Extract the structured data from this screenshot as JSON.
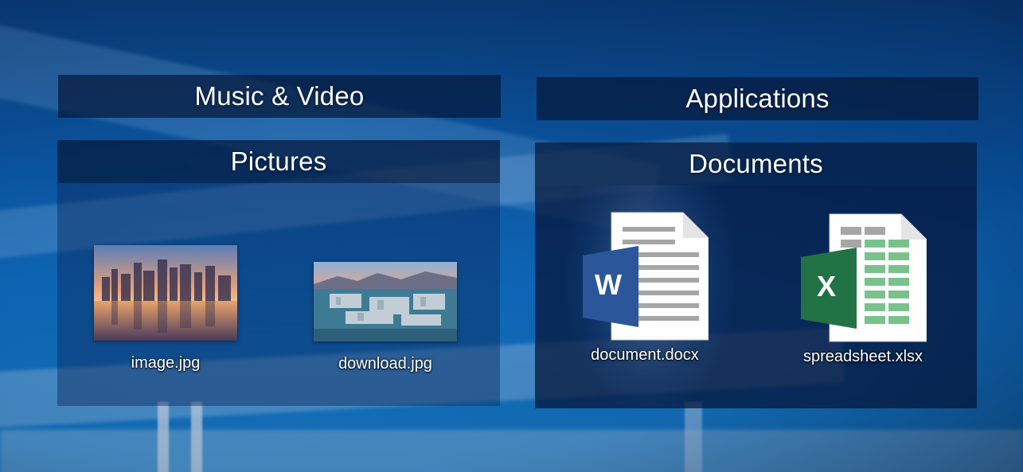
{
  "fences": {
    "music_video": {
      "title": "Music & Video"
    },
    "applications": {
      "title": "Applications"
    },
    "pictures": {
      "title": "Pictures",
      "items": [
        {
          "label": "image.jpg",
          "icon": "city-skyline-photo-thumbnail"
        },
        {
          "label": "download.jpg",
          "icon": "aerial-city-photo-thumbnail"
        }
      ]
    },
    "documents": {
      "title": "Documents",
      "items": [
        {
          "label": "document.docx",
          "icon": "word-document-icon"
        },
        {
          "label": "spreadsheet.xlsx",
          "icon": "excel-spreadsheet-icon"
        }
      ]
    }
  },
  "colors": {
    "word_blue": "#2b579a",
    "excel_green": "#217346",
    "fence_title_bg": "#05193c",
    "desktop_blue": "#0b5cab"
  }
}
